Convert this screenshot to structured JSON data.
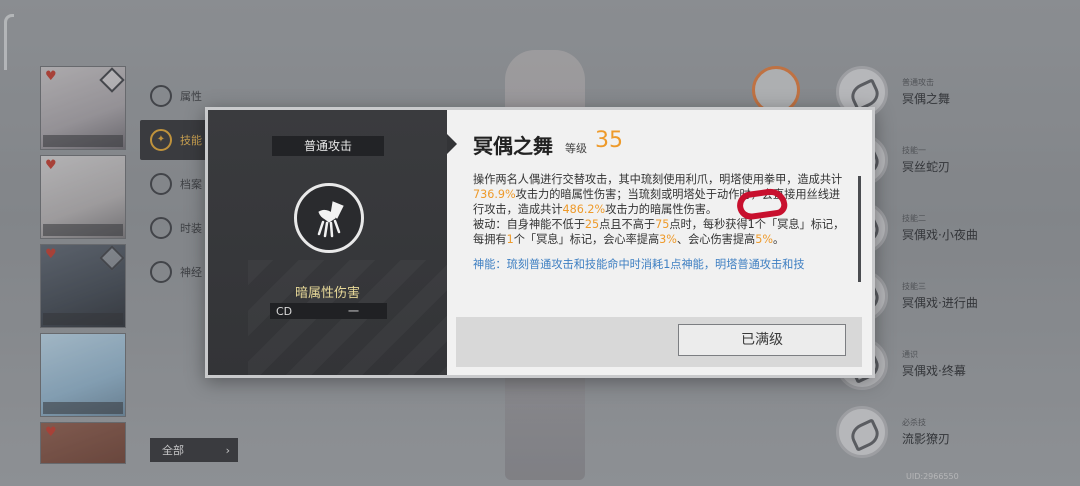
{
  "background": {
    "side_menu": [
      {
        "icon": "circle-icon",
        "label": "属性"
      },
      {
        "icon": "gear-icon",
        "label": "技能",
        "active": true
      },
      {
        "icon": "grid-icon",
        "label": "档案"
      },
      {
        "icon": "person-icon",
        "label": "时装"
      },
      {
        "icon": "shield-icon",
        "label": "神经"
      }
    ],
    "all_button": {
      "label": "全部",
      "arrow": "›"
    },
    "right_skills": [
      {
        "sub": "普通攻击",
        "name": "冥偶之舞"
      },
      {
        "sub": "技能一",
        "name": "冥丝蛇刃"
      },
      {
        "sub": "技能二",
        "name": "冥偶戏·小夜曲"
      },
      {
        "sub": "技能三",
        "name": "冥偶戏·进行曲"
      },
      {
        "sub": "通识",
        "name": "冥偶戏·终幕"
      },
      {
        "sub": "必杀技",
        "name": "流影獠刃"
      }
    ],
    "bottom_id": "UID:2966550"
  },
  "modal": {
    "left": {
      "tab_label": "普通攻击",
      "damage_type": "暗属性伤害",
      "cd_label": "CD",
      "cd_value": "一"
    },
    "right": {
      "title": "冥偶之舞",
      "level_label": "等级",
      "level_value": "35",
      "desc": {
        "p1_a": "操作两名人偶进行交替攻击，其中琉刻使用利爪，明塔使用拳甲，造成共计",
        "p1_v1": "736.9%",
        "p1_b": "攻击力的暗属性伤害；当琉刻或明塔处于动作时，会直接用丝线进行攻击，造成共计",
        "p1_v2": "486.2%",
        "p1_c": "攻击力的暗属性伤害。",
        "p2_a": "被动：自身神能不低于",
        "p2_v1": "25",
        "p2_b": "点且不高于",
        "p2_v2": "75",
        "p2_c": "点时，每秒获得1个「冥息」标记，每拥有",
        "p2_v3": "1",
        "p2_d": "个「冥息」标记，会心率提高",
        "p2_v4": "3%",
        "p2_e": "、会心伤害提高",
        "p2_v5": "5%",
        "p2_f": "。",
        "p3": "神能：琉刻普通攻击和技能命中时消耗1点神能，明塔普通攻击和技"
      },
      "maxed_button": "已满级"
    }
  },
  "colors": {
    "accent_orange": "#ee9a2a",
    "damage_gold": "#e7d898",
    "highlight_blue": "#3e7fc2",
    "annotation_red": "#c8102e"
  }
}
